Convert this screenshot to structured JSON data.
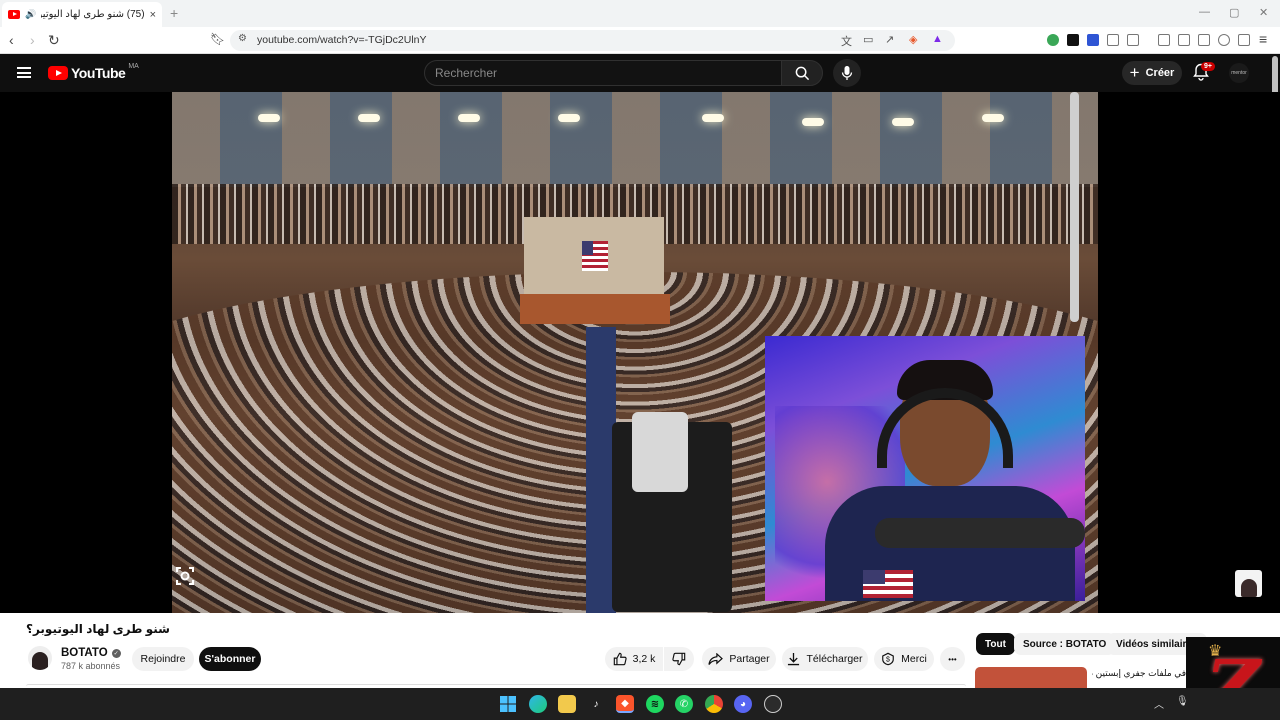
{
  "browser": {
    "tab_title": "(75) شنو طرى لهاد اليوتيوبر؟ - ...",
    "tab_close": "×",
    "new_tab": "+",
    "url": "youtube.com/watch?v=-TGjDc2UlnY",
    "window_controls": [
      "—",
      "▢",
      "✕"
    ]
  },
  "youtube": {
    "logo_text": "YouTube",
    "country_code": "MA",
    "search_placeholder": "Rechercher",
    "create_label": "Créer",
    "notifications_badge": "9+",
    "avatar_text": "mentor"
  },
  "video": {
    "title": "شنو طرى لهاد اليوتيوبر؟",
    "channel_name": "BOTATO",
    "subscribers": "787 k abonnés",
    "join_label": "Rejoindre",
    "subscribe_label": "S'abonner",
    "likes": "3,2 k",
    "share_label": "Partager",
    "download_label": "Télécharger",
    "thanks_label": "Merci",
    "more_label": "•••"
  },
  "chips": [
    {
      "label": "Tout",
      "selected": true
    },
    {
      "label": "Source : BOTATO",
      "selected": false
    },
    {
      "label": "Vidéos similaires",
      "selected": false
    }
  ],
  "related_text": "في ملفات جفري إبستين صدمت",
  "taskbar_icons": [
    "windows-start",
    "edge",
    "file-explorer",
    "tiktok",
    "brave",
    "spotify",
    "whatsapp",
    "chrome",
    "discord",
    "obs"
  ],
  "overlay_letter": "Z",
  "colors": {
    "youtube_red": "#ff0000",
    "dark_bg": "#0f0f0f",
    "chip_bg": "#f2f2f2"
  }
}
